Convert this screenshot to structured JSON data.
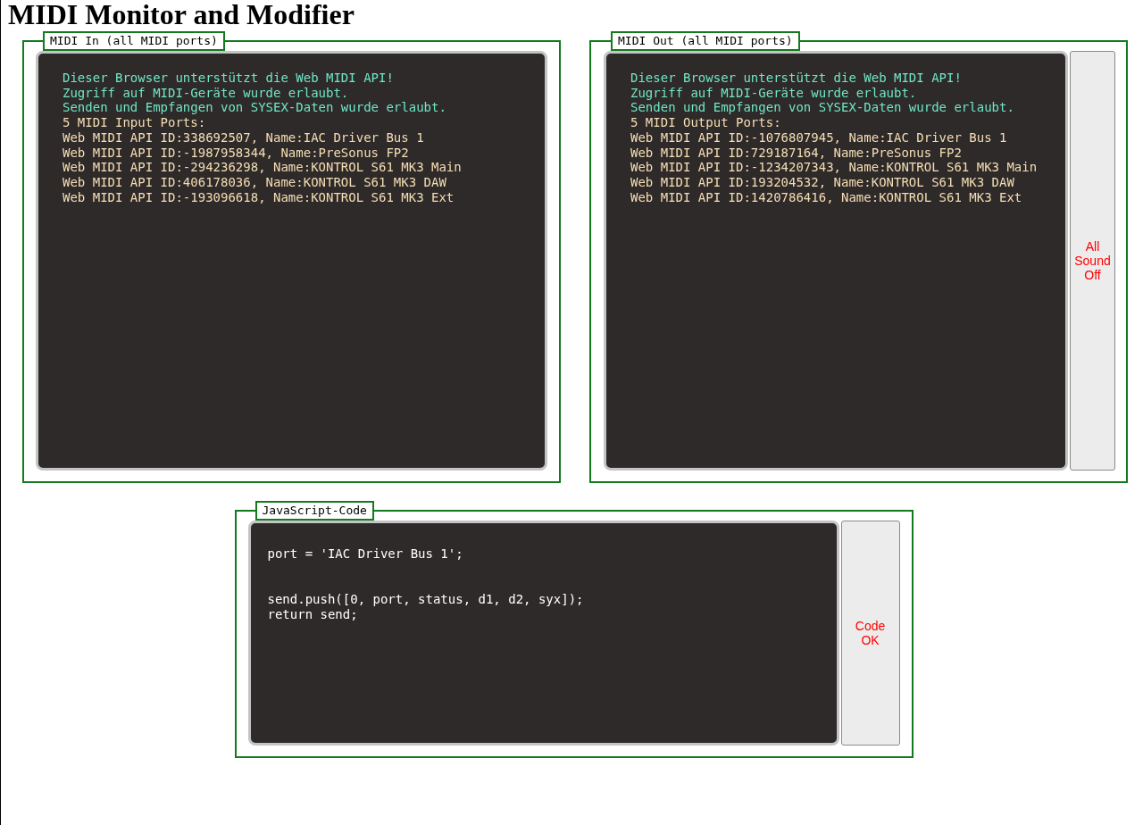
{
  "title": "MIDI Monitor and Modifier",
  "midi_in": {
    "legend": "MIDI In (all MIDI ports)",
    "lines": [
      {
        "kind": "status",
        "text": "Dieser Browser unterstützt die Web MIDI API!"
      },
      {
        "kind": "status",
        "text": "Zugriff auf MIDI-Geräte wurde erlaubt."
      },
      {
        "kind": "status",
        "text": "Senden und Empfangen von SYSEX-Daten wurde erlaubt."
      },
      {
        "kind": "port",
        "text": "5 MIDI Input Ports:"
      },
      {
        "kind": "port",
        "text": "Web MIDI API ID:338692507, Name:IAC Driver Bus 1"
      },
      {
        "kind": "port",
        "text": "Web MIDI API ID:-1987958344, Name:PreSonus FP2"
      },
      {
        "kind": "port",
        "text": "Web MIDI API ID:-294236298, Name:KONTROL S61 MK3 Main"
      },
      {
        "kind": "port",
        "text": "Web MIDI API ID:406178036, Name:KONTROL S61 MK3 DAW"
      },
      {
        "kind": "port",
        "text": "Web MIDI API ID:-193096618, Name:KONTROL S61 MK3 Ext"
      }
    ]
  },
  "midi_out": {
    "legend": "MIDI Out (all MIDI ports)",
    "button": "All Sound Off",
    "lines": [
      {
        "kind": "status",
        "text": "Dieser Browser unterstützt die Web MIDI API!"
      },
      {
        "kind": "status",
        "text": "Zugriff auf MIDI-Geräte wurde erlaubt."
      },
      {
        "kind": "status",
        "text": "Senden und Empfangen von SYSEX-Daten wurde erlaubt."
      },
      {
        "kind": "port",
        "text": "5 MIDI Output Ports:"
      },
      {
        "kind": "port",
        "text": "Web MIDI API ID:-1076807945, Name:IAC Driver Bus 1"
      },
      {
        "kind": "port",
        "text": "Web MIDI API ID:729187164, Name:PreSonus FP2"
      },
      {
        "kind": "port",
        "text": "Web MIDI API ID:-1234207343, Name:KONTROL S61 MK3 Main"
      },
      {
        "kind": "port",
        "text": "Web MIDI API ID:193204532, Name:KONTROL S61 MK3 DAW"
      },
      {
        "kind": "port",
        "text": "Web MIDI API ID:1420786416, Name:KONTROL S61 MK3 Ext"
      }
    ]
  },
  "code": {
    "legend": "JavaScript-Code",
    "button": "Code OK",
    "blocks": [
      {
        "lines": [
          "port = 'IAC Driver Bus 1';"
        ]
      },
      {
        "lines": [
          "send.push([0, port, status, d1, d2, syx]);",
          "return send;"
        ]
      }
    ]
  }
}
